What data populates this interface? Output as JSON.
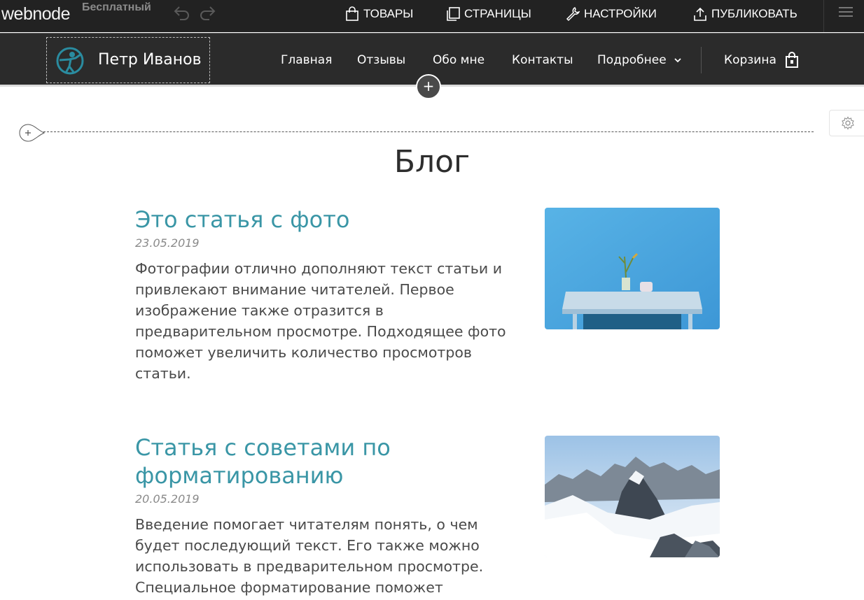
{
  "editor_bar": {
    "brand": "webnode",
    "plan": "Бесплатный",
    "menu": {
      "goods": "ТОВАРЫ",
      "pages": "СТРАНИЦЫ",
      "settings": "НАСТРОЙКИ",
      "publish": "ПУБЛИКОВАТЬ"
    }
  },
  "site_header": {
    "title": "Петр Иванов",
    "nav": [
      "Главная",
      "Отзывы",
      "Обо мне",
      "Контакты",
      "Подробнее"
    ],
    "cart": "Корзина"
  },
  "page": {
    "heading": "Блог"
  },
  "articles": [
    {
      "title": "Это статья с фото",
      "date": "23.05.2019",
      "text": "Фотографии отлично дополняют текст статьи и привлекают внимание читателей. Первое изображение также отразится в предварительном просмотре. Подходящее фото поможет увеличить количество просмотров статьи."
    },
    {
      "title": "Статья с советами по форматированию",
      "date": "20.05.2019",
      "text": "Введение помогает читателям понять, о чем будет последующий текст. Его также можно использовать в предварительном просмотре. Специальное форматирование поможет"
    }
  ],
  "colors": {
    "editor_bar_bg": "#222222",
    "site_header_bg": "#2b2b2b",
    "article_title": "#3a96a6",
    "accent_logo": "#2a8ca0"
  }
}
